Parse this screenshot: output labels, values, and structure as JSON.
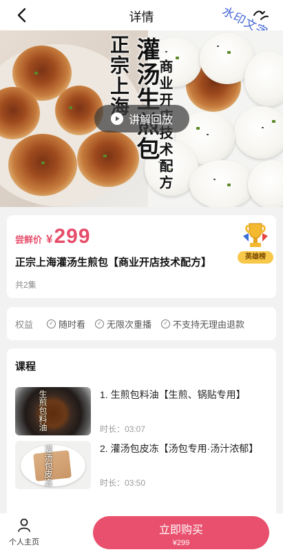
{
  "header": {
    "title": "详情",
    "watermark": "水印文字"
  },
  "hero": {
    "title_col1": "正宗上海",
    "title_col2": "灌汤生煎包",
    "title_col3": "商业开店技术配方",
    "replay_label": "讲解回放"
  },
  "price_card": {
    "price_tag": "尝鲜价",
    "currency": "¥",
    "price": "299",
    "title": "正宗上海灌汤生煎包【商业开店技术配方】",
    "episodes": "共2集",
    "badge_label": "英雄榜"
  },
  "rights": {
    "label": "权益",
    "items": [
      "随时看",
      "无限次重播",
      "不支持无理由退款"
    ]
  },
  "course": {
    "section_title": "课程",
    "lessons": [
      {
        "name": "1. 生煎包料油【生煎、锅贴专用】",
        "duration": "时长：03:07",
        "thumb_text": "生煎包料油"
      },
      {
        "name": "2. 灌汤包皮冻【汤包专用·汤汁浓郁】",
        "duration": "时长：03:50",
        "thumb_text": "灌汤包皮冻"
      }
    ]
  },
  "bottom_bar": {
    "profile_label": "个人主页",
    "buy_label": "立即购买",
    "buy_price": "¥299"
  },
  "colors": {
    "accent": "#e9506d",
    "price": "#e64d6a",
    "watermark": "#3f63d8"
  }
}
